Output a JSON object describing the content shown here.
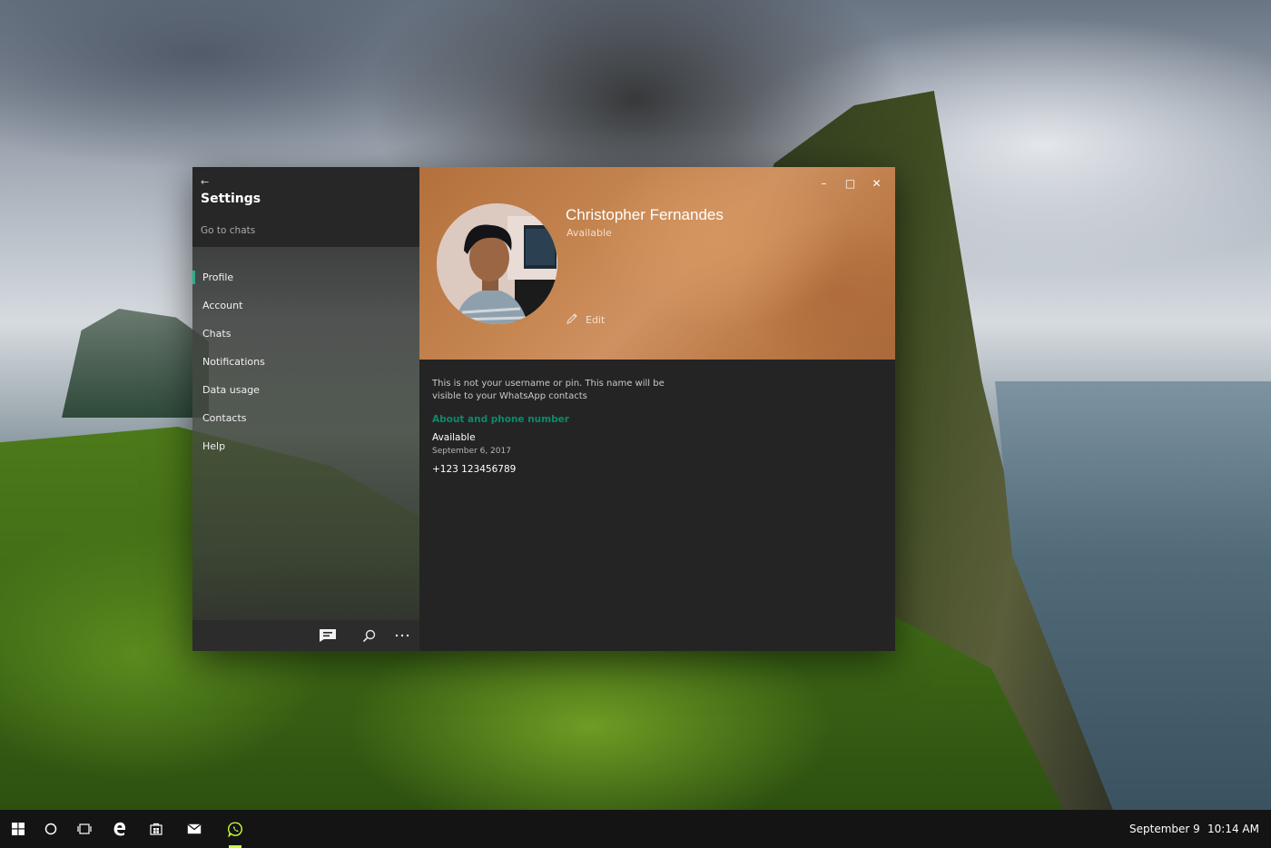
{
  "sidebar": {
    "back_glyph": "←",
    "title": "Settings",
    "go_to_chats": "Go to chats",
    "items": [
      {
        "label": "Profile",
        "active": true
      },
      {
        "label": "Account"
      },
      {
        "label": "Chats"
      },
      {
        "label": "Notifications"
      },
      {
        "label": "Data usage"
      },
      {
        "label": "Contacts"
      },
      {
        "label": "Help"
      }
    ],
    "bottom_icons": [
      "new-chat-icon",
      "search-icon",
      "more-icon"
    ]
  },
  "window_controls": {
    "minimize": "–",
    "maximize": "□",
    "close": "✕"
  },
  "profile": {
    "name": "Christopher Fernandes",
    "status": "Available",
    "edit_label": "Edit",
    "info_text": "This is not your username or pin. This name will be visible to your WhatsApp contacts",
    "section_title": "About and phone number",
    "about": "Available",
    "about_date": "September 6, 2017",
    "phone": "+123 123456789"
  },
  "taskbar": {
    "icons": [
      "windows-start-icon",
      "cortana-icon",
      "task-view-icon",
      "edge-icon",
      "store-icon",
      "mail-icon",
      "whatsapp-icon"
    ],
    "active_app": "whatsapp-icon",
    "date": "September 9",
    "time": "10:14 AM"
  },
  "colors": {
    "accent": "#25b089",
    "section_title": "#0b8a6a",
    "header": "#c4844f",
    "taskbar_active": "#c6ff3c"
  }
}
